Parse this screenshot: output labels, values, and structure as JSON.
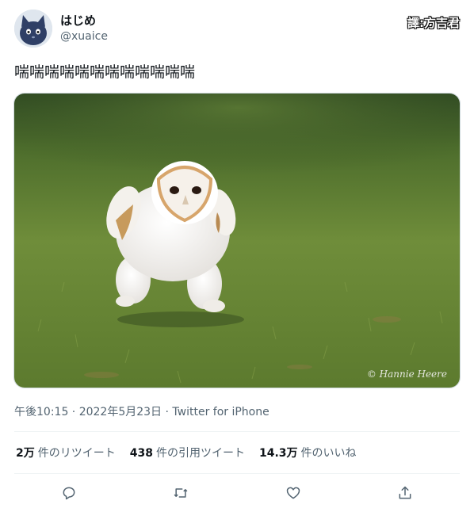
{
  "tweet": {
    "display_name": "はじめ",
    "handle": "@xuaice",
    "credit_overlay": "譯:方吉君",
    "text": "喘喘喘喘喘喘喘喘喘喘喘喘",
    "photo_credit": "© Hannie Heere",
    "timestamp": "午後10:15 · 2022年5月23日 · Twitter for iPhone"
  },
  "stats": {
    "retweets_count": "2万",
    "retweets_label": "件のリツイート",
    "quotes_count": "438",
    "quotes_label": "件の引用ツイート",
    "likes_count": "14.3万",
    "likes_label": "件のいいね"
  },
  "icons": [
    "avatar-cat-icon",
    "reply-icon",
    "retweet-icon",
    "like-icon",
    "share-icon"
  ],
  "colors": {
    "text": "#0f1419",
    "secondary": "#536471",
    "divider": "#eff3f4",
    "grass": "#5f7f2f"
  }
}
